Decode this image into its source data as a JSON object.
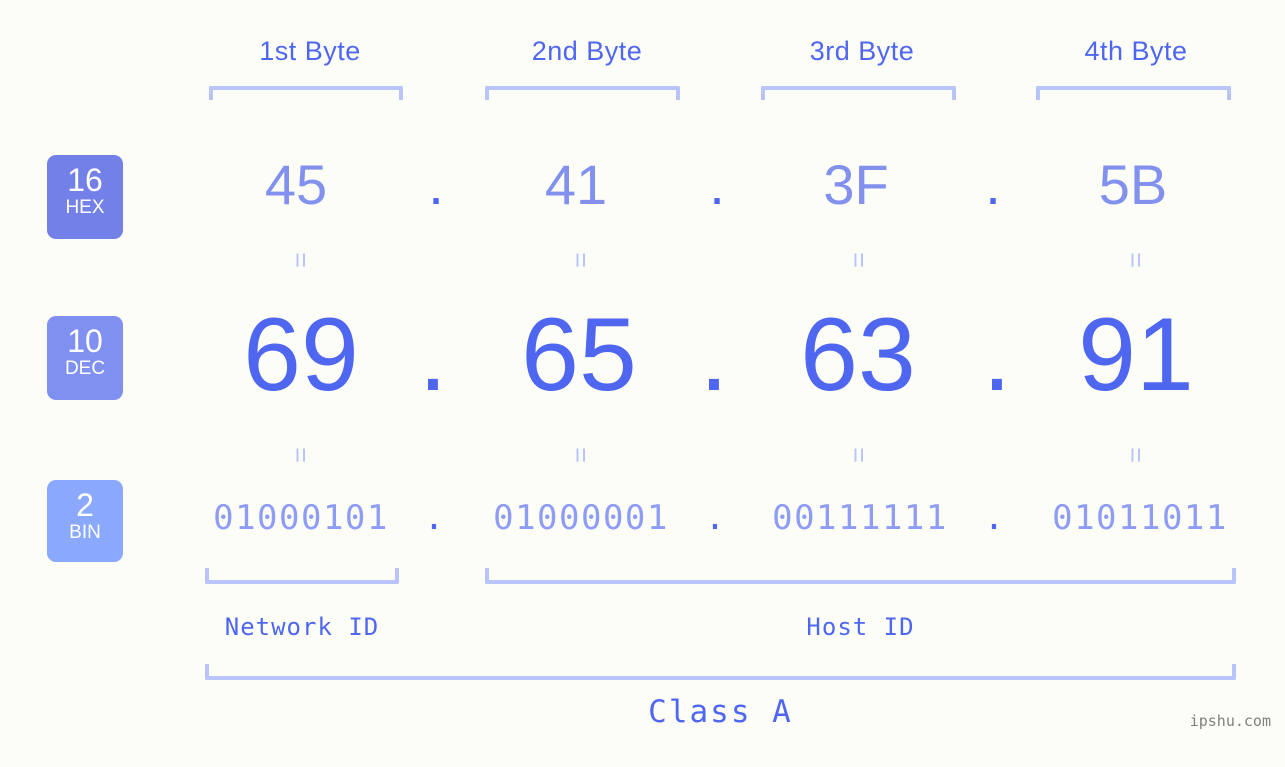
{
  "background": "#fcfdf7",
  "colors": {
    "accent_strong": "#4f67f0",
    "accent_mid": "#8290ee",
    "accent_light": "#8e9cf5",
    "bracket": "#b8c4fb",
    "badge_hex": "#7280e8",
    "badge_dec": "#8090f0",
    "badge_bin": "#8aa8fc",
    "watermark": "#808080"
  },
  "byte_headers": [
    {
      "label": "1st Byte"
    },
    {
      "label": "2nd Byte"
    },
    {
      "label": "3rd Byte"
    },
    {
      "label": "4th Byte"
    }
  ],
  "bases": [
    {
      "id": "hex",
      "number": "16",
      "abbr": "HEX"
    },
    {
      "id": "dec",
      "number": "10",
      "abbr": "DEC"
    },
    {
      "id": "bin",
      "number": "2",
      "abbr": "BIN"
    }
  ],
  "separator": ".",
  "equals_glyph": "=",
  "rows": {
    "hex": {
      "values": [
        "45",
        "41",
        "3F",
        "5B"
      ]
    },
    "dec": {
      "values": [
        "69",
        "65",
        "63",
        "91"
      ]
    },
    "bin": {
      "values": [
        "01000101",
        "01000001",
        "00111111",
        "01011011"
      ]
    }
  },
  "segments": {
    "network_id": "Network ID",
    "host_id": "Host ID",
    "class": "Class A"
  },
  "watermark": "ipshu.com"
}
